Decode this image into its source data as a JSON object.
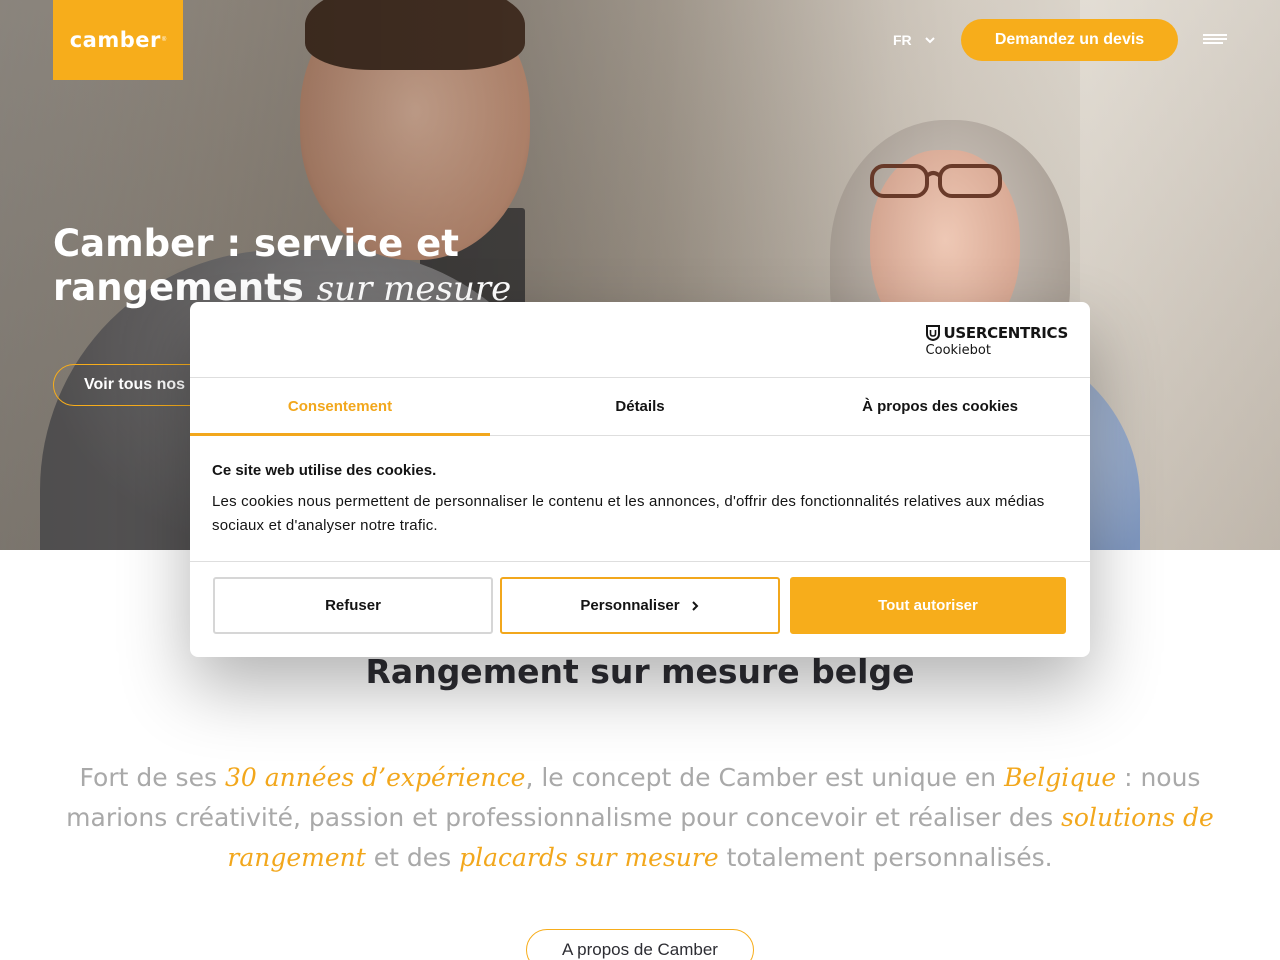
{
  "header": {
    "logo_text": "camber",
    "logo_mark": "®",
    "language": "FR",
    "quote_button": "Demandez un devis",
    "menu_icon": "hamburger-icon"
  },
  "hero": {
    "title_bold": "Camber : service et rangements",
    "title_italic": "sur mesure",
    "button_label": "Voir tous nos"
  },
  "cookie_dialog": {
    "brand_name": "USERCENTRICS",
    "brand_sub": "Cookiebot",
    "tabs": [
      {
        "label": "Consentement",
        "active": true
      },
      {
        "label": "Détails",
        "active": false
      },
      {
        "label": "À propos des cookies",
        "active": false
      }
    ],
    "heading": "Ce site web utilise des cookies.",
    "body": "Les cookies nous permettent de personnaliser le contenu et les annonces, d'offrir des fonctionnalités relatives aux médias sociaux et d'analyser notre trafic.",
    "buttons": {
      "refuse": "Refuser",
      "customize": "Personnaliser",
      "allow_all": "Tout autoriser"
    }
  },
  "main": {
    "section_title": "Rangement sur mesure belge",
    "intro_parts": {
      "p1": "Fort de ses ",
      "h1": "30 années d’expérience",
      "p2": ", le concept de Camber est unique en ",
      "h2": "Belgique",
      "p3": " : nous marions créativité, passion et professionnalisme pour concevoir et réaliser des ",
      "h3": "solutions de rangement",
      "p4": " et des ",
      "h4": "placards sur mesure",
      "p5": " totalement personnalisés."
    },
    "about_button": "A propos de Camber"
  },
  "colors": {
    "accent": "#f7ad1b",
    "heading": "#2d2d33",
    "muted_text": "#a9a9a9"
  }
}
